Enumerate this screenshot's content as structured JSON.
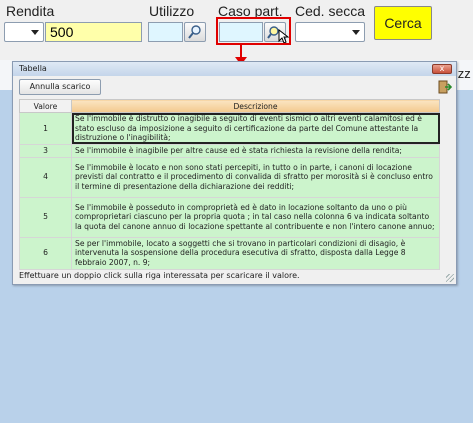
{
  "toolbar": {
    "rendita_label": "Rendita",
    "rendita_value": "500",
    "utilizzo_label": "Utilizzo",
    "caso_label": "Caso part.",
    "ced_label": "Ced. secca",
    "cerca_label": "Cerca",
    "accent_yellow": "#ffff00",
    "highlight_red": "#e00000"
  },
  "background_fragment": "lizz",
  "window": {
    "title": "Tabella",
    "close_label": "x",
    "annulla_label": "Annulla scarico",
    "columns": [
      "Valore",
      "Descrizione"
    ],
    "rows": [
      {
        "valore": "1",
        "descrizione": "Se l'immobile è distrutto o inagibile a seguito di eventi sismici o altri eventi calamitosi ed è stato escluso da imposizione a seguito di certificazione da parte del Comune attestante la distruzione o l'inagibilità;"
      },
      {
        "valore": "3",
        "descrizione": "Se l'immobile è inagibile per altre cause ed è stata richiesta la revisione della rendita;"
      },
      {
        "valore": "4",
        "descrizione": "Se l'immobile è locato e non sono stati percepiti, in tutto o in parte, i canoni di locazione previsti dal contratto e il procedimento di convalida di sfratto per morosità si è concluso entro il termine di presentazione della dichiarazione dei redditi;"
      },
      {
        "valore": "5",
        "descrizione": "Se l'immobile è posseduto in comproprietà ed è dato in locazione soltanto da uno o più comproprietari ciascuno per la propria quota ; in tal caso nella colonna 6 va indicata soltanto la quota del canone annuo di locazione spettante al contribuente e non l'intero canone annuo;"
      },
      {
        "valore": "6",
        "descrizione": "Se per l'immobile, locato a soggetti che si trovano in particolari condizioni di disagio, è intervenuta la sospensione della procedura esecutiva di sfratto, disposta dalla Legge 8 febbraio 2007, n. 9;"
      }
    ],
    "hint": "Effettuare un doppio click sulla riga interessata per scaricare il valore."
  }
}
